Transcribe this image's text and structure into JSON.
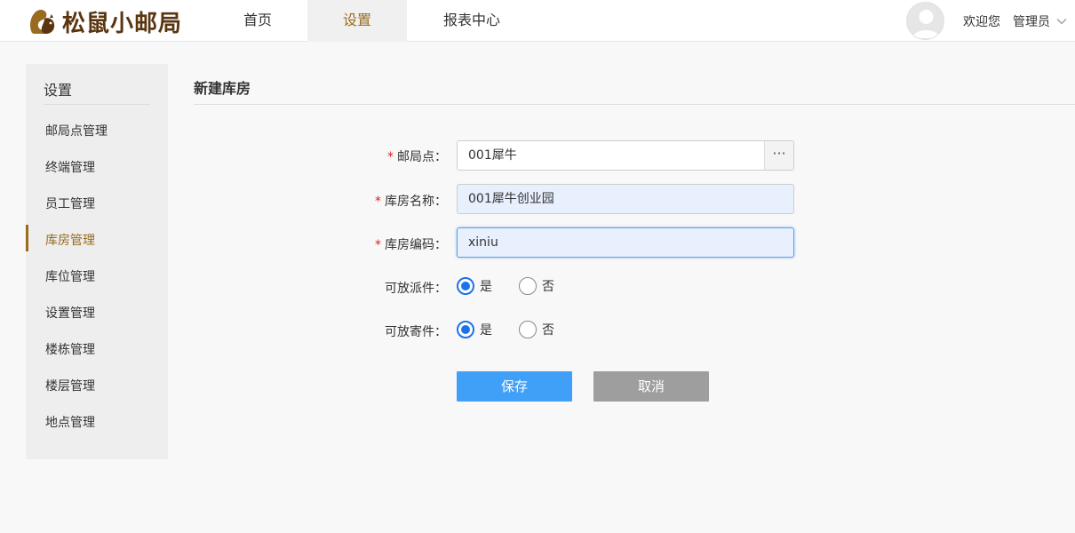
{
  "app": {
    "logo_text": "松鼠小邮局"
  },
  "nav": {
    "items": [
      "首页",
      "设置",
      "报表中心"
    ],
    "active": 1
  },
  "user": {
    "welcome": "欢迎您",
    "name": "管理员"
  },
  "sidebar": {
    "title": "设置",
    "items": [
      "邮局点管理",
      "终端管理",
      "员工管理",
      "库房管理",
      "库位管理",
      "设置管理",
      "楼栋管理",
      "楼层管理",
      "地点管理"
    ],
    "active": 3
  },
  "main": {
    "title": "新建库房",
    "form": {
      "post_office": {
        "label": "邮局点：",
        "value": "001犀牛",
        "picker": "···"
      },
      "warehouse_name": {
        "label": "库房名称：",
        "value": "001犀牛创业园"
      },
      "warehouse_code": {
        "label": "库房编码：",
        "value": "xiniu"
      },
      "allow_delivery": {
        "label": "可放派件：",
        "options": [
          "是",
          "否"
        ],
        "selected": "是"
      },
      "allow_sending": {
        "label": "可放寄件：",
        "options": [
          "是",
          "否"
        ],
        "selected": "是"
      },
      "required_mark": "*"
    },
    "buttons": {
      "save": "保存",
      "cancel": "取消"
    }
  },
  "colors": {
    "brand": "#5a3510",
    "accent": "#9a6b1e",
    "primary": "#40a0f8",
    "radio": "#1a73e8"
  }
}
